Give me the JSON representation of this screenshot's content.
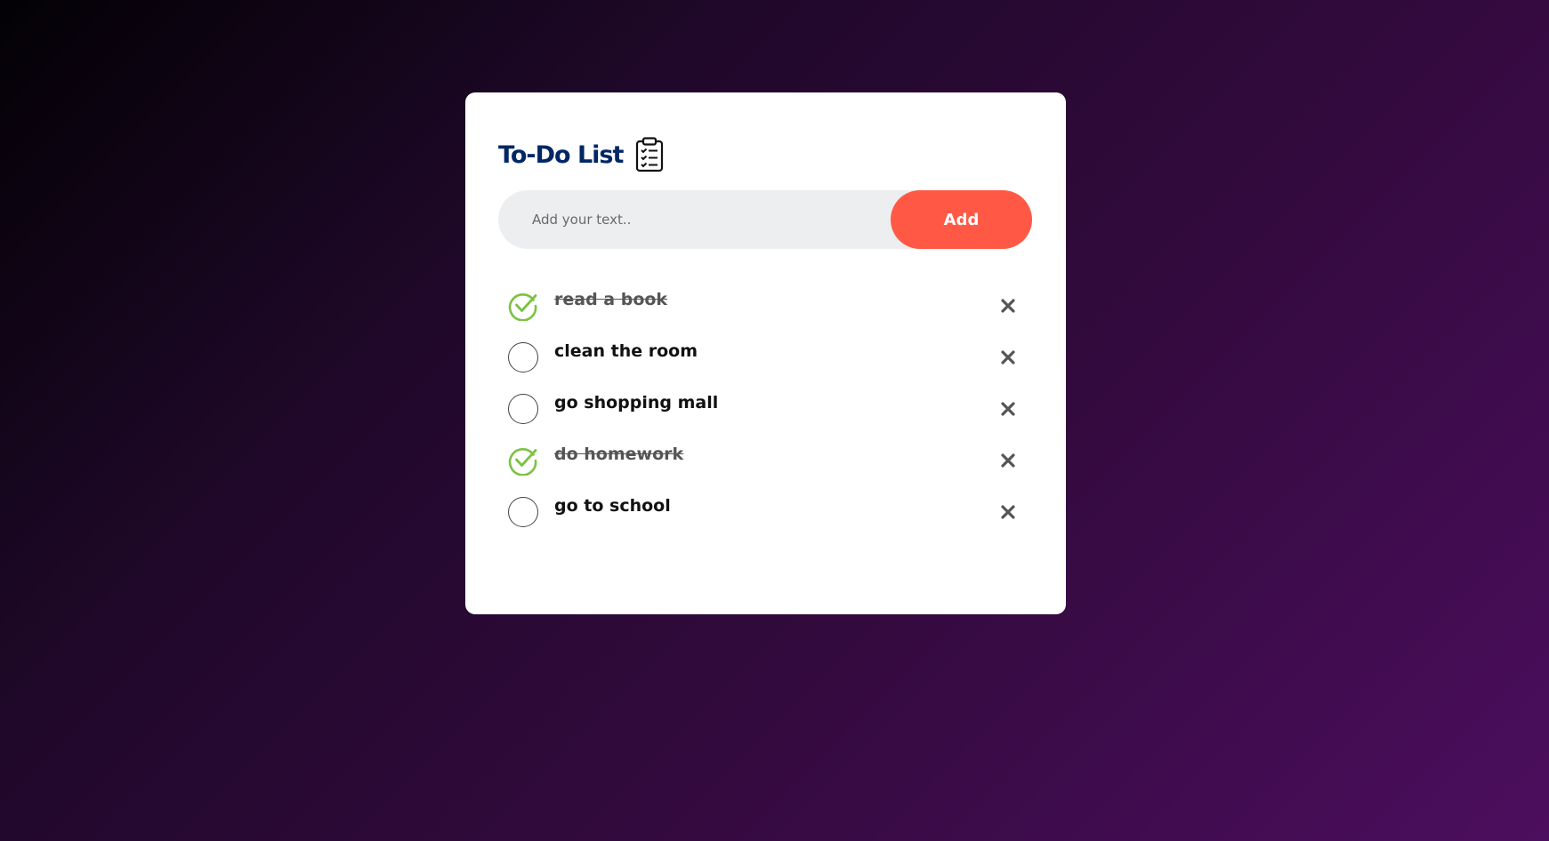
{
  "app": {
    "title": "To-Do List",
    "title_icon": "clipboard-checklist-icon"
  },
  "form": {
    "placeholder": "Add your text..",
    "value": "",
    "add_label": "Add"
  },
  "colors": {
    "title": "#002765",
    "accent": "#ff5945",
    "check": "#7cc242",
    "input_bg": "#edeef0"
  },
  "tasks": [
    {
      "text": "read a book",
      "done": true
    },
    {
      "text": "clean the room",
      "done": false
    },
    {
      "text": "go shopping mall",
      "done": false
    },
    {
      "text": "do homework",
      "done": true
    },
    {
      "text": "go to school",
      "done": false
    }
  ],
  "icons": {
    "checked": "check-circle-icon",
    "unchecked": "empty-circle-icon",
    "delete": "close-icon"
  }
}
